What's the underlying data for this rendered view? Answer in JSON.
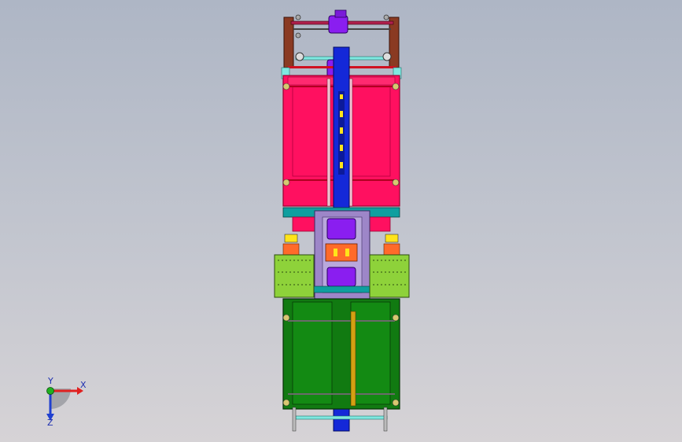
{
  "viewport": {
    "background_top": "#aeb6c5",
    "background_bottom": "#d6d3d6"
  },
  "model": {
    "palette": {
      "red_panel": "#ff1060",
      "red_outline": "#9a0030",
      "green_panel": "#117a11",
      "lime_panel": "#8ed23a",
      "blue_belt": "#1428d8",
      "purple_roller": "#8a1ef0",
      "lavender_frame": "#9d86c8",
      "teal_bar": "#0f9f9f",
      "yellow": "#ffe41a",
      "orange": "#ff6a2a",
      "brown_post": "#8a3a22",
      "cyan_rod": "#7fe8e0",
      "gold_rail": "#d4a012"
    }
  },
  "triad": {
    "x_label": "X",
    "y_label": "Y",
    "z_label": "Z",
    "x_color": "#e02020",
    "y_color": "#20b020",
    "z_color": "#2040d0"
  }
}
